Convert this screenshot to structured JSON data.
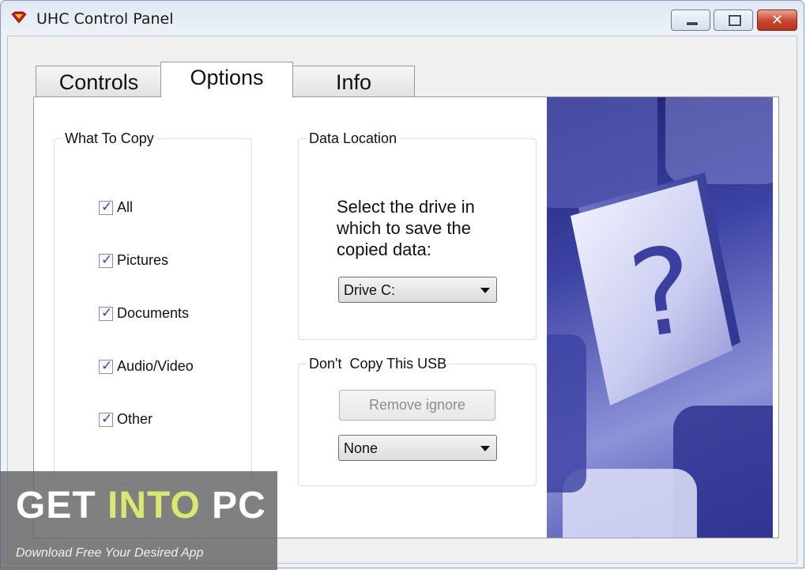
{
  "window": {
    "title": "UHC Control Panel",
    "icon": "superman-shield-icon",
    "buttons": {
      "minimize": "minimize-icon",
      "maximize": "maximize-icon",
      "close": "✕"
    }
  },
  "tabs": [
    {
      "label": "Controls",
      "active": false
    },
    {
      "label": "Options",
      "active": true
    },
    {
      "label": "Info",
      "active": false
    }
  ],
  "what_to_copy": {
    "title": "What To Copy",
    "items": [
      {
        "label": "All",
        "checked": true
      },
      {
        "label": "Pictures",
        "checked": true
      },
      {
        "label": "Documents",
        "checked": true
      },
      {
        "label": "Audio/Video",
        "checked": true
      },
      {
        "label": "Other",
        "checked": true
      }
    ]
  },
  "data_location": {
    "title": "Data Location",
    "description": "Select the drive in which to save the copied data:",
    "drive_value": "Drive C:"
  },
  "dont_copy": {
    "title": "Don't  Copy This USB",
    "remove_button": "Remove ignore",
    "usb_value": "None"
  },
  "watermark": {
    "get": "GET",
    "into": "INTO",
    "pc": "PC",
    "tagline": "Download Free Your Desired App"
  },
  "colors": {
    "accent": "#2a4dab",
    "watermark_highlight": "#d9e86f"
  }
}
